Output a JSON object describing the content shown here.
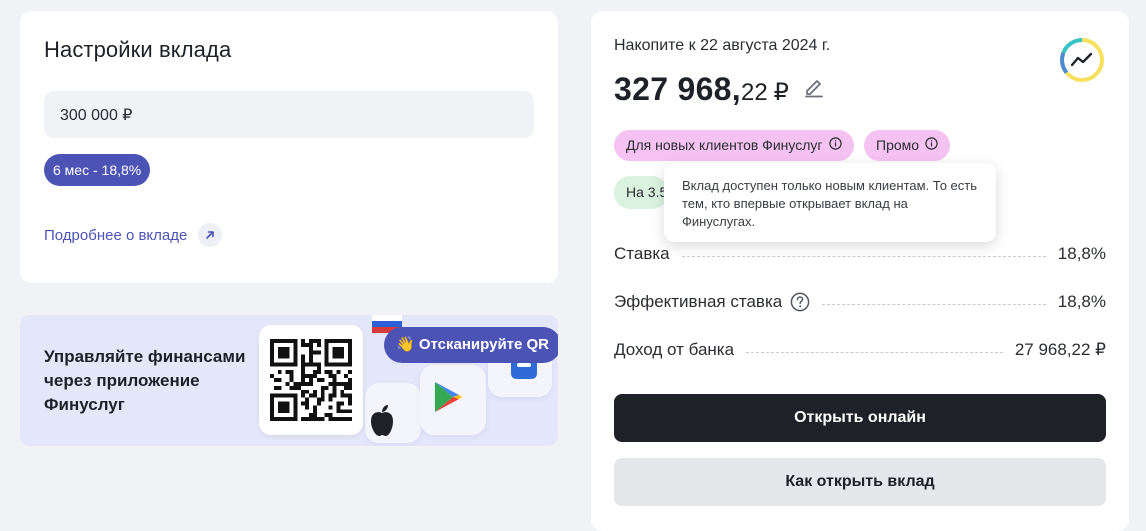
{
  "settings": {
    "title": "Настройки вклада",
    "amount_value": "300 000 ₽",
    "term_chip": "6 мес - 18,8%",
    "more_link": "Подробнее о вкладе"
  },
  "promo": {
    "text": "Управляйте финансами через приложение Финуслуг",
    "scan_label": "👋 Отсканируйте QR"
  },
  "summary": {
    "accumulate_label": "Накопите к 22 августа 2024 г.",
    "amount_int": "327 968,",
    "amount_frac": "22",
    "currency": "₽",
    "tags": [
      "Для новых клиентов Финуслуг",
      "Промо"
    ],
    "green_tag": "На 3.5",
    "tooltip": "Вклад доступен только новым клиентам. То есть тем, кто впервые открывает вклад на Финуслугах.",
    "rows": [
      {
        "label": "Ставка",
        "value": "18,8%"
      },
      {
        "label": "Эффективная ставка",
        "value": "18,8%"
      },
      {
        "label": "Доход от банка",
        "value": "27 968,22 ₽"
      }
    ],
    "open_online": "Открыть онлайн",
    "how_to_open": "Как открыть вклад"
  },
  "colors": {
    "accent": "#4b53b4",
    "tag_pink": "#f5c2f2",
    "tag_green": "#daf3df",
    "dark_button": "#1f2128"
  }
}
